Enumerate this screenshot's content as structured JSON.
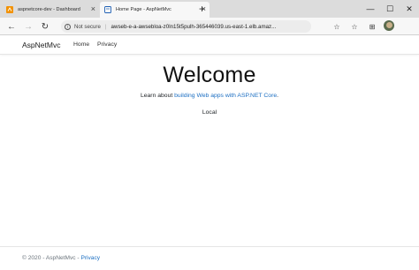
{
  "browser": {
    "tabs": [
      {
        "title": "aspnetcore-dev - Dashboard",
        "active": false
      },
      {
        "title": "Home Page - AspNetMvc",
        "active": true
      }
    ],
    "new_tab": "+",
    "window_controls": {
      "minimize": "—",
      "maximize": "☐",
      "close": "✕"
    },
    "address": {
      "security_label": "Not secure",
      "separator": "|",
      "url": "awseb-e-a-awsebloa-z0ln15t5pulh-365446039.us-east-1.elb.amaz..."
    },
    "icons": {
      "back": "←",
      "forward": "→",
      "refresh": "↻",
      "favorite": "☆",
      "collections": "⊞",
      "tab_close": "×"
    }
  },
  "site": {
    "brand": "AspNetMvc",
    "nav": {
      "home": "Home",
      "privacy": "Privacy"
    },
    "heading": "Welcome",
    "learn_prefix": "Learn about ",
    "learn_link": "building Web apps with ASP.NET Core",
    "learn_suffix": ".",
    "environment": "Local",
    "footer": {
      "copyright": "© 2020 - AspNetMvc - ",
      "privacy_link": "Privacy"
    }
  },
  "colors": {
    "link": "#1b6ec2",
    "tab_strip": "#dcdcdc",
    "toolbar": "#f7f7f7",
    "aws_favicon": "#f29100",
    "page_favicon": "#1e5fb4"
  }
}
